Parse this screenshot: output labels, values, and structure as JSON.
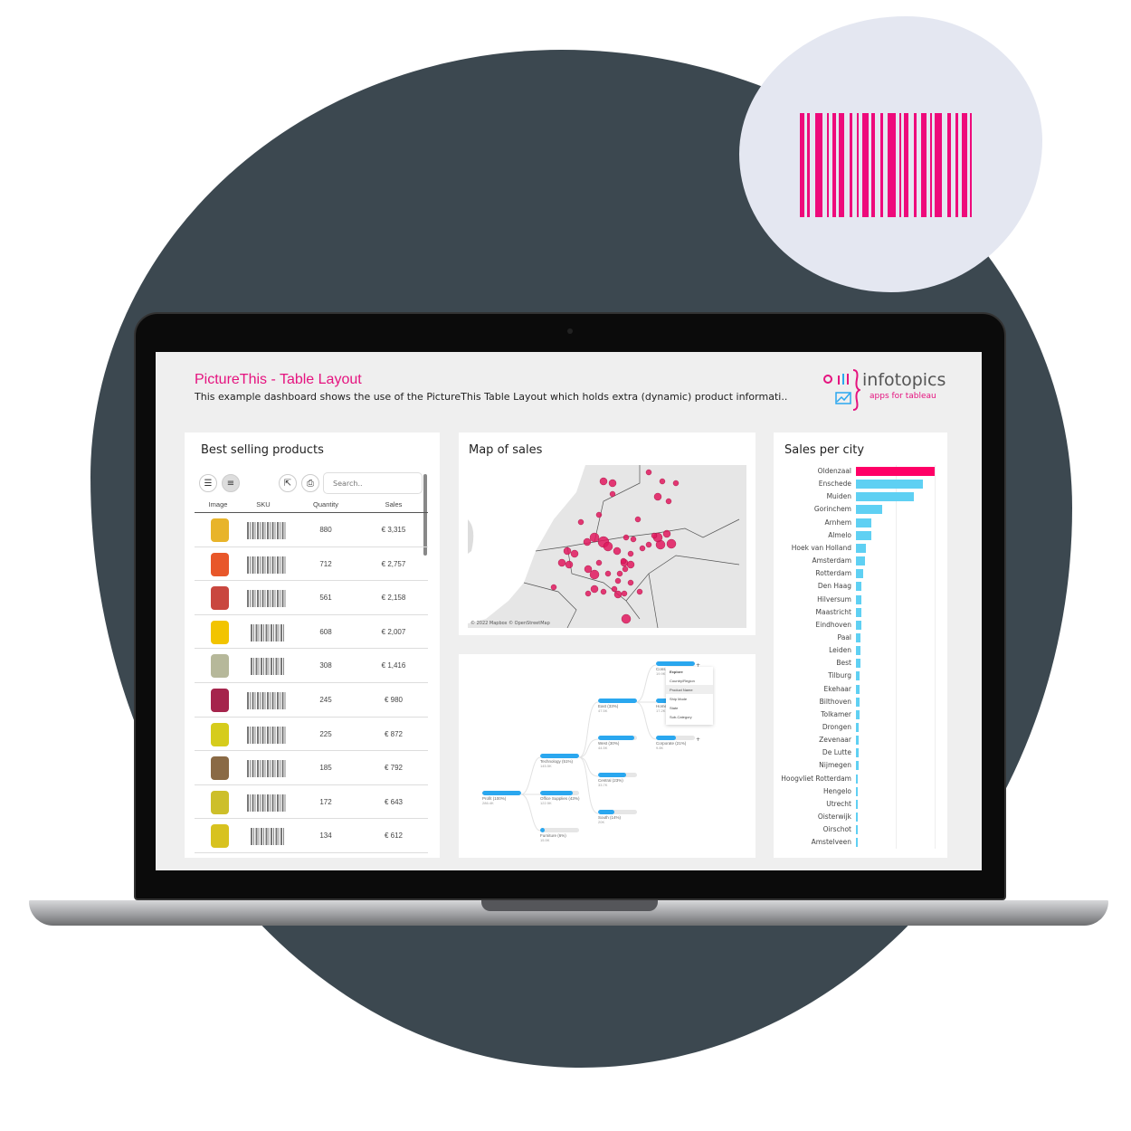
{
  "colors": {
    "accent": "#e5137f",
    "bar": "#5fd0f3",
    "highlight": "#ff0066",
    "dark_blob": "#3c4850",
    "light_blob": "#e4e7f1"
  },
  "header": {
    "title": "PictureThis - Table Layout",
    "subtitle": "This example dashboard shows the use of the PictureThis Table Layout  which holds extra (dynamic) product informati..",
    "logo_text": "infotopics",
    "logo_tagline": "apps for tableau"
  },
  "products": {
    "title": "Best selling products",
    "search_placeholder": "Search..",
    "tools": [
      "sort-ascending-icon",
      "sort-descending-icon",
      "export-icon",
      "print-icon"
    ],
    "columns": [
      "Image",
      "SKU",
      "Quantity",
      "Sales"
    ],
    "rows": [
      {
        "quantity": "880",
        "sales": "€ 3,315",
        "color": "#e8b42a"
      },
      {
        "quantity": "712",
        "sales": "€ 2,757",
        "color": "#e8572a"
      },
      {
        "quantity": "561",
        "sales": "€ 2,158",
        "color": "#c9473f"
      },
      {
        "quantity": "608",
        "sales": "€ 2,007",
        "color": "#f2c400"
      },
      {
        "quantity": "308",
        "sales": "€ 1,416",
        "color": "#b6b89a"
      },
      {
        "quantity": "245",
        "sales": "€ 980",
        "color": "#a5244c"
      },
      {
        "quantity": "225",
        "sales": "€ 872",
        "color": "#d6cc1c"
      },
      {
        "quantity": "185",
        "sales": "€ 792",
        "color": "#8a6a45"
      },
      {
        "quantity": "172",
        "sales": "€ 643",
        "color": "#cdbf2a"
      },
      {
        "quantity": "134",
        "sales": "€ 612",
        "color": "#d8c21f"
      }
    ]
  },
  "map": {
    "title": "Map of sales",
    "attribution": "© 2022 Mapbox © OpenStreetMap"
  },
  "tree": {
    "nodes": [
      {
        "label": "Profit (100%)",
        "value": "286.4K",
        "fill": 1.0
      },
      {
        "label": "Technology (51%)",
        "value": "145.5K",
        "fill": 1.0
      },
      {
        "label": "Office Supplies (43%)",
        "value": "122.5K",
        "fill": 0.84
      },
      {
        "label": "Furniture (6%)",
        "value": "15.5K",
        "fill": 0.12
      },
      {
        "label": "East (33%)",
        "value": "47.5K",
        "fill": 1.0
      },
      {
        "label": "West (30%)",
        "value": "44.5K",
        "fill": 0.94
      },
      {
        "label": "Central (23%)",
        "value": "33.7K",
        "fill": 0.72
      },
      {
        "label": "South (14%)",
        "value": "20K",
        "fill": 0.43
      },
      {
        "label": "Cons",
        "value": "19.9K",
        "fill": 1.0
      },
      {
        "label": "Home",
        "value": "17.2K",
        "fill": 0.87
      },
      {
        "label": "Corporate (21%)",
        "value": "9.8K",
        "fill": 0.5
      }
    ],
    "menu": [
      "Explore",
      "Country/Region",
      "Product Name",
      "Ship Mode",
      "State",
      "Sub-Category"
    ]
  },
  "cities": {
    "title": "Sales per city",
    "chart_data": {
      "type": "bar",
      "orientation": "horizontal",
      "highlight": "Oldenzaal",
      "categories": [
        "Oldenzaal",
        "Enschede",
        "Muiden",
        "Gorinchem",
        "Arnhem",
        "Almelo",
        "Hoek van Holland",
        "Amsterdam",
        "Rotterdam",
        "Den Haag",
        "Hilversum",
        "Maastricht",
        "Eindhoven",
        "Paal",
        "Leiden",
        "Best",
        "Tilburg",
        "Ekehaar",
        "Bilthoven",
        "Tolkamer",
        "Drongen",
        "Zevenaar",
        "De Lutte",
        "Nijmegen",
        "Hoogvliet Rotterdam",
        "Hengelo",
        "Utrecht",
        "Oisterwijk",
        "Oirschot",
        "Amstelveen"
      ],
      "values": [
        100,
        85,
        74,
        33,
        20,
        19,
        13,
        11,
        9,
        7,
        7,
        7,
        7,
        6,
        6,
        5.5,
        5,
        4.5,
        4.5,
        4.5,
        4,
        4,
        4,
        4,
        2.5,
        2.5,
        2.5,
        2.5,
        1.5,
        1.5
      ]
    }
  }
}
